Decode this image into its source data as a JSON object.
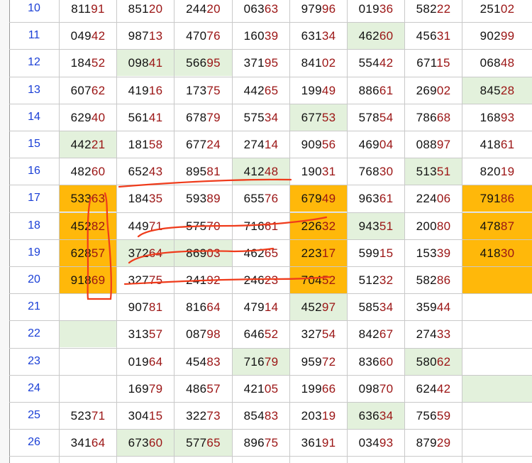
{
  "rows": [
    {
      "num": "10",
      "cells": [
        {
          "v": "81191"
        },
        {
          "v": "85120"
        },
        {
          "v": "24420"
        },
        {
          "v": "06363"
        },
        {
          "v": "97996"
        },
        {
          "v": "01936"
        },
        {
          "v": "58222"
        },
        {
          "v": "25102"
        }
      ]
    },
    {
      "num": "11",
      "cells": [
        {
          "v": "04942"
        },
        {
          "v": "98713"
        },
        {
          "v": "47076"
        },
        {
          "v": "16039"
        },
        {
          "v": "63134"
        },
        {
          "v": "46260",
          "bg": "green"
        },
        {
          "v": "45631"
        },
        {
          "v": "90299"
        }
      ]
    },
    {
      "num": "12",
      "cells": [
        {
          "v": "18452"
        },
        {
          "v": "09841",
          "bg": "green"
        },
        {
          "v": "56695",
          "bg": "green"
        },
        {
          "v": "37195"
        },
        {
          "v": "84102"
        },
        {
          "v": "55442"
        },
        {
          "v": "67115"
        },
        {
          "v": "06848"
        }
      ]
    },
    {
      "num": "13",
      "cells": [
        {
          "v": "60762"
        },
        {
          "v": "41916"
        },
        {
          "v": "17375"
        },
        {
          "v": "44265"
        },
        {
          "v": "19949"
        },
        {
          "v": "88661"
        },
        {
          "v": "26902"
        },
        {
          "v": "84528",
          "bg": "green"
        }
      ]
    },
    {
      "num": "14",
      "cells": [
        {
          "v": "62940"
        },
        {
          "v": "56141"
        },
        {
          "v": "67879"
        },
        {
          "v": "57534"
        },
        {
          "v": "67753",
          "bg": "green"
        },
        {
          "v": "57854"
        },
        {
          "v": "78668"
        },
        {
          "v": "16893"
        }
      ]
    },
    {
      "num": "15",
      "cells": [
        {
          "v": "44221",
          "bg": "green"
        },
        {
          "v": "18158"
        },
        {
          "v": "67724"
        },
        {
          "v": "27414"
        },
        {
          "v": "90956"
        },
        {
          "v": "46904"
        },
        {
          "v": "08897"
        },
        {
          "v": "41861"
        }
      ]
    },
    {
      "num": "16",
      "cells": [
        {
          "v": "48260"
        },
        {
          "v": "65243"
        },
        {
          "v": "89581"
        },
        {
          "v": "41248",
          "bg": "green"
        },
        {
          "v": "19031"
        },
        {
          "v": "76830"
        },
        {
          "v": "51351",
          "bg": "green"
        },
        {
          "v": "82019"
        }
      ]
    },
    {
      "num": "17",
      "cells": [
        {
          "v": "53363",
          "bg": "orange"
        },
        {
          "v": "18435"
        },
        {
          "v": "59389"
        },
        {
          "v": "65576"
        },
        {
          "v": "67949",
          "bg": "orange"
        },
        {
          "v": "96361"
        },
        {
          "v": "22406"
        },
        {
          "v": "79186",
          "bg": "orange"
        }
      ]
    },
    {
      "num": "18",
      "cells": [
        {
          "v": "45282",
          "bg": "orange"
        },
        {
          "v": "44971"
        },
        {
          "v": "57570"
        },
        {
          "v": "71661"
        },
        {
          "v": "22632",
          "bg": "orange"
        },
        {
          "v": "94351",
          "bg": "green"
        },
        {
          "v": "20080"
        },
        {
          "v": "47887",
          "bg": "orange"
        }
      ]
    },
    {
      "num": "19",
      "cells": [
        {
          "v": "62857",
          "bg": "orange"
        },
        {
          "v": "37264",
          "bg": "green"
        },
        {
          "v": "86903",
          "bg": "green"
        },
        {
          "v": "46265"
        },
        {
          "v": "22317",
          "bg": "orange"
        },
        {
          "v": "59915"
        },
        {
          "v": "15339"
        },
        {
          "v": "41830",
          "bg": "orange"
        }
      ]
    },
    {
      "num": "20",
      "cells": [
        {
          "v": "91869",
          "bg": "orange"
        },
        {
          "v": "32775"
        },
        {
          "v": "24192"
        },
        {
          "v": "24623"
        },
        {
          "v": "70452",
          "bg": "orange"
        },
        {
          "v": "51232"
        },
        {
          "v": "58286"
        },
        {
          "v": "",
          "bg": "orange"
        }
      ]
    },
    {
      "num": "21",
      "cells": [
        {
          "v": ""
        },
        {
          "v": "90781"
        },
        {
          "v": "81664"
        },
        {
          "v": "47914"
        },
        {
          "v": "45297",
          "bg": "green"
        },
        {
          "v": "58534"
        },
        {
          "v": "35944"
        },
        {
          "v": ""
        }
      ]
    },
    {
      "num": "22",
      "cells": [
        {
          "v": "",
          "bg": "green"
        },
        {
          "v": "31357"
        },
        {
          "v": "08798"
        },
        {
          "v": "64652"
        },
        {
          "v": "32754"
        },
        {
          "v": "84267"
        },
        {
          "v": "27433"
        },
        {
          "v": ""
        }
      ]
    },
    {
      "num": "23",
      "cells": [
        {
          "v": ""
        },
        {
          "v": "01964"
        },
        {
          "v": "45483"
        },
        {
          "v": "71679",
          "bg": "green"
        },
        {
          "v": "95972"
        },
        {
          "v": "83660"
        },
        {
          "v": "58062",
          "bg": "green"
        },
        {
          "v": ""
        }
      ]
    },
    {
      "num": "24",
      "cells": [
        {
          "v": ""
        },
        {
          "v": "16979"
        },
        {
          "v": "48657"
        },
        {
          "v": "42105"
        },
        {
          "v": "19966"
        },
        {
          "v": "09870"
        },
        {
          "v": "62442"
        },
        {
          "v": "",
          "bg": "green"
        }
      ]
    },
    {
      "num": "25",
      "cells": [
        {
          "v": "52371"
        },
        {
          "v": "30415"
        },
        {
          "v": "32273"
        },
        {
          "v": "85483"
        },
        {
          "v": "20319"
        },
        {
          "v": "63634",
          "bg": "green"
        },
        {
          "v": "75659"
        },
        {
          "v": ""
        }
      ]
    },
    {
      "num": "26",
      "cells": [
        {
          "v": "34164"
        },
        {
          "v": "67360",
          "bg": "green"
        },
        {
          "v": "57765",
          "bg": "green"
        },
        {
          "v": "89675"
        },
        {
          "v": "36191"
        },
        {
          "v": "03493"
        },
        {
          "v": "87929"
        },
        {
          "v": ""
        }
      ]
    }
  ],
  "colors": {
    "row_number": "#1a3fd6",
    "tail_digits": "#9b1414",
    "orange": "#ffb80a",
    "green": "#e3f1dc",
    "annotation": "#ef3b1b"
  }
}
